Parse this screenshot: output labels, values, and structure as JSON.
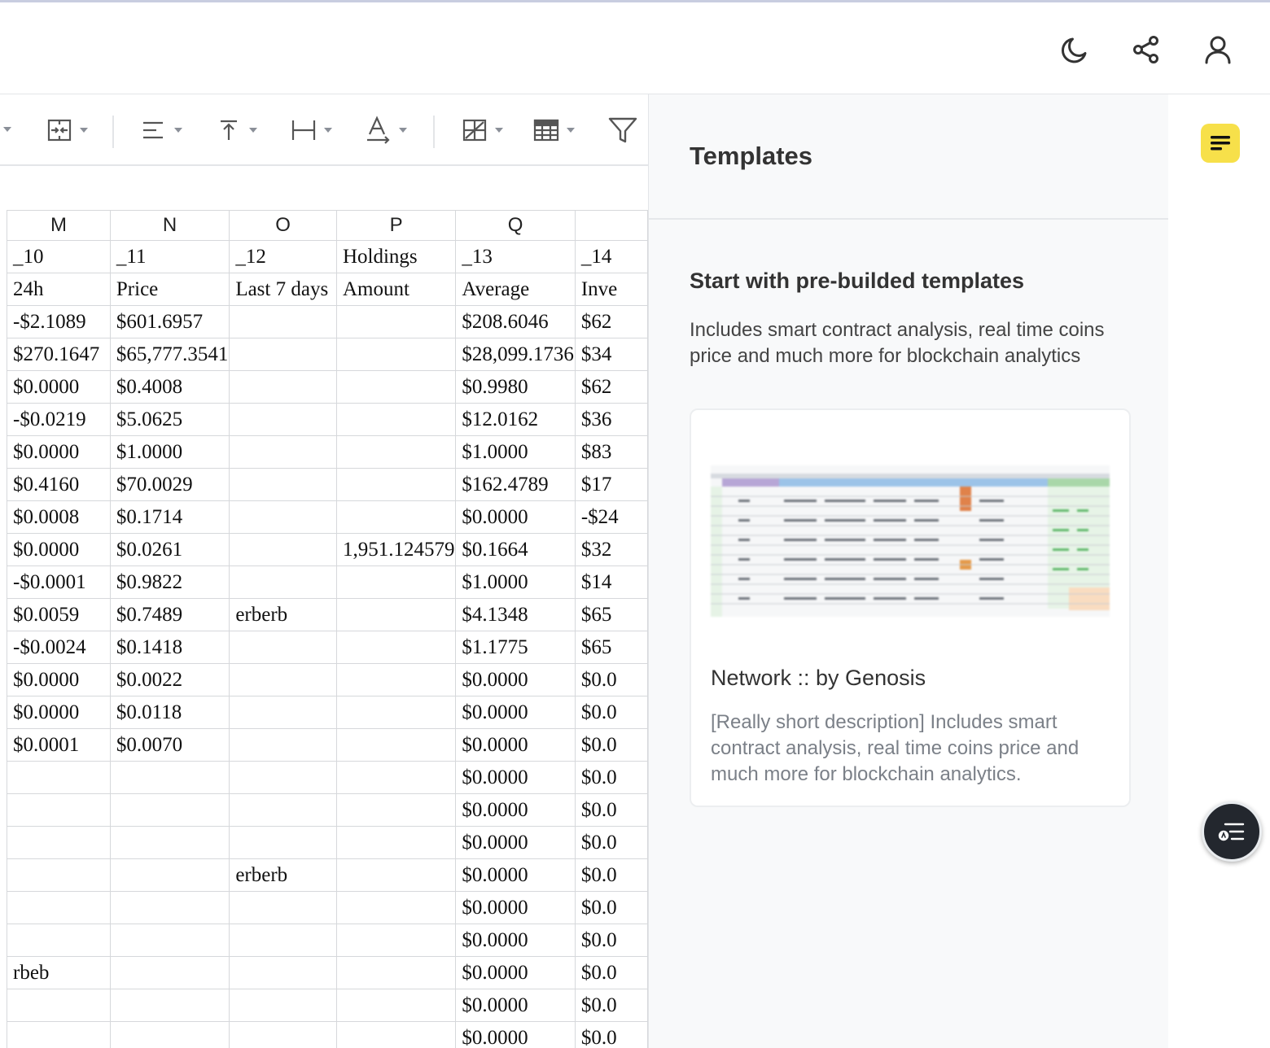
{
  "header": {
    "icons": [
      "moon-icon",
      "share-icon",
      "user-icon"
    ]
  },
  "toolbar": {
    "icons": [
      "merge-cells-icon",
      "align-left-icon",
      "vertical-align-top-icon",
      "text-wrap-icon",
      "text-color-icon",
      "borders-icon",
      "table-format-icon",
      "filter-icon"
    ]
  },
  "grid": {
    "columns": [
      "M",
      "N",
      "O",
      "P",
      "Q",
      ""
    ],
    "rows": [
      [
        "_10",
        "_11",
        "_12",
        "Holdings",
        "_13",
        "_14"
      ],
      [
        "24h",
        "Price",
        "Last 7 days",
        "Amount",
        "Average",
        "Inve"
      ],
      [
        "-$2.1089",
        "$601.6957",
        "",
        "",
        "$208.6046",
        "$62"
      ],
      [
        "$270.1647",
        "$65,777.3541",
        "",
        "",
        "$28,099.1736",
        "$34"
      ],
      [
        "$0.0000",
        "$0.4008",
        "",
        "",
        "$0.9980",
        "$62"
      ],
      [
        "-$0.0219",
        "$5.0625",
        "",
        "",
        "$12.0162",
        "$36"
      ],
      [
        "$0.0000",
        "$1.0000",
        "",
        "",
        "$1.0000",
        "$83"
      ],
      [
        "$0.4160",
        "$70.0029",
        "",
        "",
        "$162.4789",
        "$17"
      ],
      [
        "$0.0008",
        "$0.1714",
        "",
        "",
        "$0.0000",
        "-$24"
      ],
      [
        "$0.0000",
        "$0.0261",
        "",
        "1,951.124579",
        "$0.1664",
        "$32"
      ],
      [
        "-$0.0001",
        "$0.9822",
        "",
        "",
        "$1.0000",
        "$14"
      ],
      [
        "$0.0059",
        "$0.7489",
        "erberb",
        "",
        "$4.1348",
        "$65"
      ],
      [
        "-$0.0024",
        "$0.1418",
        "",
        "",
        "$1.1775",
        "$65"
      ],
      [
        "$0.0000",
        "$0.0022",
        "",
        "",
        "$0.0000",
        "$0.0"
      ],
      [
        "$0.0000",
        "$0.0118",
        "",
        "",
        "$0.0000",
        "$0.0"
      ],
      [
        "$0.0001",
        "$0.0070",
        "",
        "",
        "$0.0000",
        "$0.0"
      ],
      [
        "",
        "",
        "",
        "",
        "$0.0000",
        "$0.0"
      ],
      [
        "",
        "",
        "",
        "",
        "$0.0000",
        "$0.0"
      ],
      [
        "",
        "",
        "",
        "",
        "$0.0000",
        "$0.0"
      ],
      [
        "",
        "",
        "erberb",
        "",
        "$0.0000",
        "$0.0"
      ],
      [
        "",
        "",
        "",
        "",
        "$0.0000",
        "$0.0"
      ],
      [
        "",
        "",
        "",
        "",
        "$0.0000",
        "$0.0"
      ],
      [
        "rbeb",
        "",
        "",
        "",
        "$0.0000",
        "$0.0"
      ],
      [
        "",
        "",
        "",
        "",
        "$0.0000",
        "$0.0"
      ],
      [
        "",
        "",
        "",
        "",
        "$0.0000",
        "$0.0"
      ]
    ]
  },
  "panel": {
    "title": "Templates",
    "subtitle": "Start with pre-builded templates",
    "description": "Includes smart contract analysis, real time coins price and much more for blockchain analytics",
    "card": {
      "title": "Network :: by Genosis",
      "description": "[Really short description] Includes smart contract analysis, real time coins price and much more for blockchain analytics."
    }
  },
  "rail": {
    "icons": [
      "notes-icon"
    ]
  },
  "fab": {
    "icon": "ai-assistant-icon"
  }
}
